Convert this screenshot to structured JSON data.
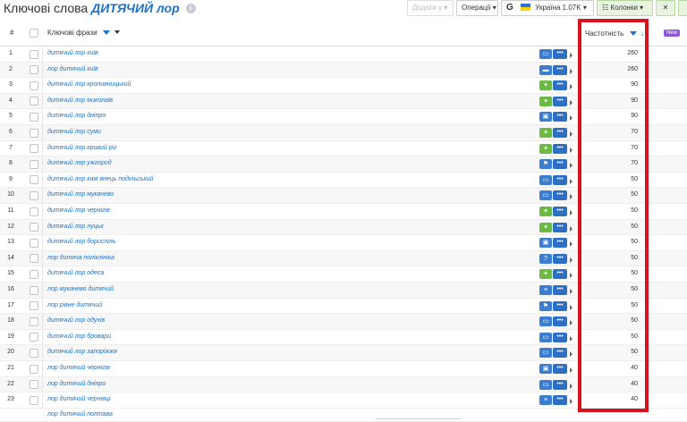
{
  "header": {
    "title_prefix": "Ключові слова",
    "title_keyword": "ДИТЯЧИЙ лор",
    "info_icon": "info-icon",
    "add_to_button": "Додати у",
    "operations_button": "Операції",
    "google_label": "G",
    "region_button": "Україна 1.07K",
    "columns_button": "Колонки",
    "close_label": "✕"
  },
  "table": {
    "col_number": "#",
    "col_phrase": "Ключові фрази",
    "col_frequency": "Частотність",
    "new_badge": "New",
    "rows": [
      {
        "n": "1",
        "phrase": "дитячий лор київ",
        "feature": "message-icon",
        "color": "blue",
        "freq": "260"
      },
      {
        "n": "2",
        "phrase": "лор дитячий київ",
        "feature": "sitelinks-icon",
        "color": "blue",
        "freq": "260"
      },
      {
        "n": "3",
        "phrase": "дитячий лор кропивницький",
        "feature": "local-pack-icon",
        "color": "green",
        "freq": "90"
      },
      {
        "n": "4",
        "phrase": "дитячий лор миколаїв",
        "feature": "local-pack-icon",
        "color": "green",
        "freq": "90"
      },
      {
        "n": "5",
        "phrase": "дитячий лор дніпро",
        "feature": "image-pack-icon",
        "color": "blue",
        "freq": "90"
      },
      {
        "n": "6",
        "phrase": "дитячий лор суми",
        "feature": "local-pack-icon",
        "color": "green",
        "freq": "70"
      },
      {
        "n": "7",
        "phrase": "дитячий лор кривий ріг",
        "feature": "local-pack-icon",
        "color": "green",
        "freq": "70"
      },
      {
        "n": "8",
        "phrase": "дитячий лор ужгород",
        "feature": "map-flag-icon",
        "color": "blue",
        "freq": "70"
      },
      {
        "n": "9",
        "phrase": "дитячий лор кам янець подільський",
        "feature": "message-icon",
        "color": "blue",
        "freq": "50"
      },
      {
        "n": "10",
        "phrase": "дитячий лор мукачево",
        "feature": "message-icon",
        "color": "blue",
        "freq": "50"
      },
      {
        "n": "11",
        "phrase": "дитячий лор чернігів",
        "feature": "local-pack-icon",
        "color": "green",
        "freq": "50"
      },
      {
        "n": "12",
        "phrase": "дитячий лор луцьк",
        "feature": "local-pack-icon",
        "color": "green",
        "freq": "50"
      },
      {
        "n": "13",
        "phrase": "дитячий лор бориспіль",
        "feature": "image-pack-icon",
        "color": "blue",
        "freq": "50"
      },
      {
        "n": "14",
        "phrase": "лор дитяча поліклініка",
        "feature": "question-icon",
        "color": "blue",
        "freq": "50"
      },
      {
        "n": "15",
        "phrase": "дитячий лор одеса",
        "feature": "local-pack-icon",
        "color": "green",
        "freq": "50"
      },
      {
        "n": "16",
        "phrase": "лор мукачево дитячий",
        "feature": "list-icon",
        "color": "blue",
        "freq": "50"
      },
      {
        "n": "17",
        "phrase": "лор рівне дитячий",
        "feature": "map-flag-icon",
        "color": "blue",
        "freq": "50"
      },
      {
        "n": "18",
        "phrase": "дитячий лор одухів",
        "feature": "message-icon",
        "color": "blue",
        "freq": "50"
      },
      {
        "n": "19",
        "phrase": "дитячий лор бровари",
        "feature": "message-icon",
        "color": "blue",
        "freq": "50"
      },
      {
        "n": "20",
        "phrase": "дитячий лор запоріжжя",
        "feature": "message-icon",
        "color": "blue",
        "freq": "50"
      },
      {
        "n": "21",
        "phrase": "лор дитячий чернігів",
        "feature": "image-pack-icon",
        "color": "blue",
        "freq": "40"
      },
      {
        "n": "22",
        "phrase": "лор дитячий дніпро",
        "feature": "message-icon",
        "color": "blue",
        "freq": "40"
      },
      {
        "n": "23",
        "phrase": "лор дитячий чернівці",
        "feature": "list-icon",
        "color": "blue",
        "freq": "40"
      }
    ],
    "partial_row_phrase": "лор дитячий полтава"
  },
  "colors": {
    "link": "#1a73c7",
    "highlight": "#d9121f",
    "feature_blue": "#3a7dd1",
    "feature_green": "#6dba43"
  }
}
